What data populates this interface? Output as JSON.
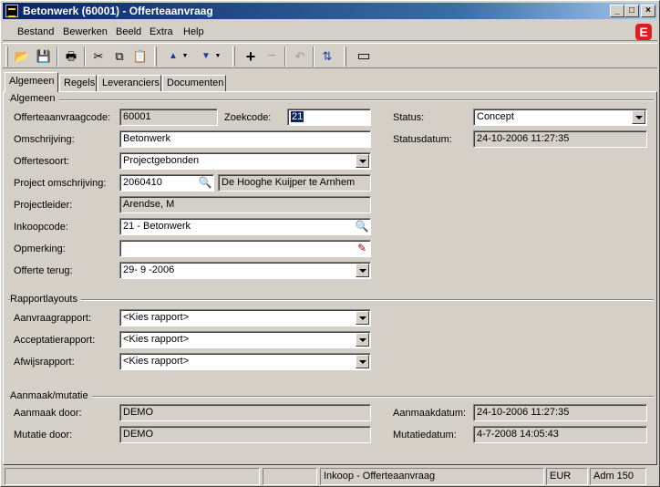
{
  "window": {
    "title": "Betonwerk (60001) - Offerteaanvraag",
    "minimize": "_",
    "maximize": "□",
    "close": "×"
  },
  "menu": [
    "Bestand",
    "Bewerken",
    "Beeld",
    "Extra",
    "Help"
  ],
  "tabs": [
    "Algemeen",
    "Regels",
    "Leveranciers",
    "Documenten"
  ],
  "groups": {
    "algemeen": "Algemeen",
    "rapportlayouts": "Rapportlayouts",
    "aanmaak": "Aanmaak/mutatie"
  },
  "form": {
    "offerteaanvraagcode": {
      "label": "Offerteaanvraagcode:",
      "value": "60001"
    },
    "zoekcode": {
      "label": "Zoekcode:",
      "value": "21"
    },
    "status": {
      "label": "Status:",
      "value": "Concept"
    },
    "statusdatum": {
      "label": "Statusdatum:",
      "value": "24-10-2006 11:27:35"
    },
    "omschrijving": {
      "label": "Omschrijving:",
      "value": "Betonwerk"
    },
    "offertesoort": {
      "label": "Offertesoort:",
      "value": "Projectgebonden"
    },
    "project": {
      "label": "Project omschrijving:",
      "value": "2060410",
      "description": "De Hooghe Kuijper te Arnhem"
    },
    "projectleider": {
      "label": "Projectleider:",
      "value": "Arendse, M"
    },
    "inkoopcode": {
      "label": "Inkoopcode:",
      "value": "21 - Betonwerk"
    },
    "opmerking": {
      "label": "Opmerking:",
      "value": ""
    },
    "offerte_terug": {
      "label": "Offerte terug:",
      "value": "29- 9 -2006"
    },
    "aanvraagrapport": {
      "label": "Aanvraagrapport:",
      "value": "<Kies rapport>"
    },
    "acceptatierapport": {
      "label": "Acceptatierapport:",
      "value": "<Kies rapport>"
    },
    "afwijsrapport": {
      "label": "Afwijsrapport:",
      "value": "<Kies rapport>"
    },
    "aanmaak_door": {
      "label": "Aanmaak door:",
      "value": "DEMO"
    },
    "mutatie_door": {
      "label": "Mutatie door:",
      "value": "DEMO"
    },
    "aanmaakdatum": {
      "label": "Aanmaakdatum:",
      "value": "24-10-2006 11:27:35"
    },
    "mutatiedatum": {
      "label": "Mutatiedatum:",
      "value": "4-7-2008 14:05:43"
    }
  },
  "statusbar": {
    "context": "Inkoop - Offerteaanvraag",
    "currency": "EUR",
    "admin": "Adm 150"
  },
  "brand": "E",
  "icons": {
    "open": "📂",
    "save": "💾",
    "print": "🖶",
    "cut": "✂",
    "copy": "⧉",
    "paste": "📋",
    "up": "▲",
    "down": "▼",
    "add": "+",
    "remove": "−",
    "undo": "↶",
    "refresh": "⇅",
    "window": "▭",
    "lookup": "🔍",
    "edit": "✎"
  }
}
